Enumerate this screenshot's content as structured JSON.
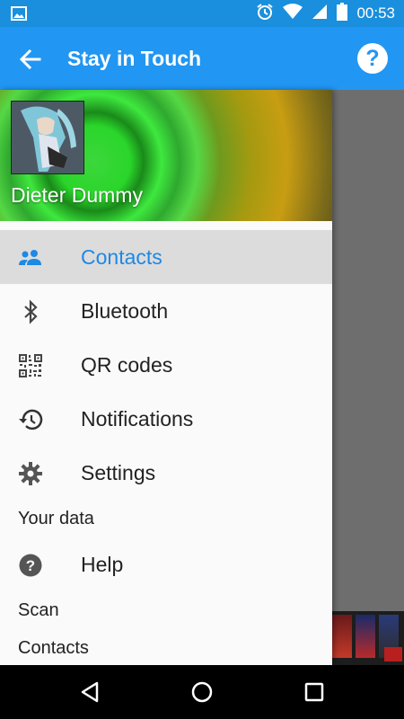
{
  "status_bar": {
    "time": "00:53",
    "icons": [
      "image-icon",
      "alarm-icon",
      "wifi-icon",
      "signal-icon",
      "battery-icon"
    ]
  },
  "app_bar": {
    "title": "Stay in Touch",
    "back_icon": "arrow-back-icon",
    "help_icon": "help-icon",
    "help_glyph": "?"
  },
  "drawer": {
    "user_name": "Dieter Dummy",
    "items": [
      {
        "label": "Contacts",
        "icon": "people-icon",
        "active": true
      },
      {
        "label": "Bluetooth",
        "icon": "bluetooth-icon",
        "active": false
      },
      {
        "label": "QR codes",
        "icon": "qr-code-icon",
        "active": false
      },
      {
        "label": "Notifications",
        "icon": "history-icon",
        "active": false
      },
      {
        "label": "Settings",
        "icon": "gear-icon",
        "active": false
      }
    ],
    "section_your_data": "Your data",
    "help_item": {
      "label": "Help",
      "icon": "help-circle-icon"
    },
    "section_scan": "Scan",
    "section_contacts": "Contacts"
  },
  "colors": {
    "primary": "#2196f3",
    "status_bar": "#1a8fdd",
    "active_text": "#1e88e5",
    "active_bg": "#dcdcdc"
  }
}
